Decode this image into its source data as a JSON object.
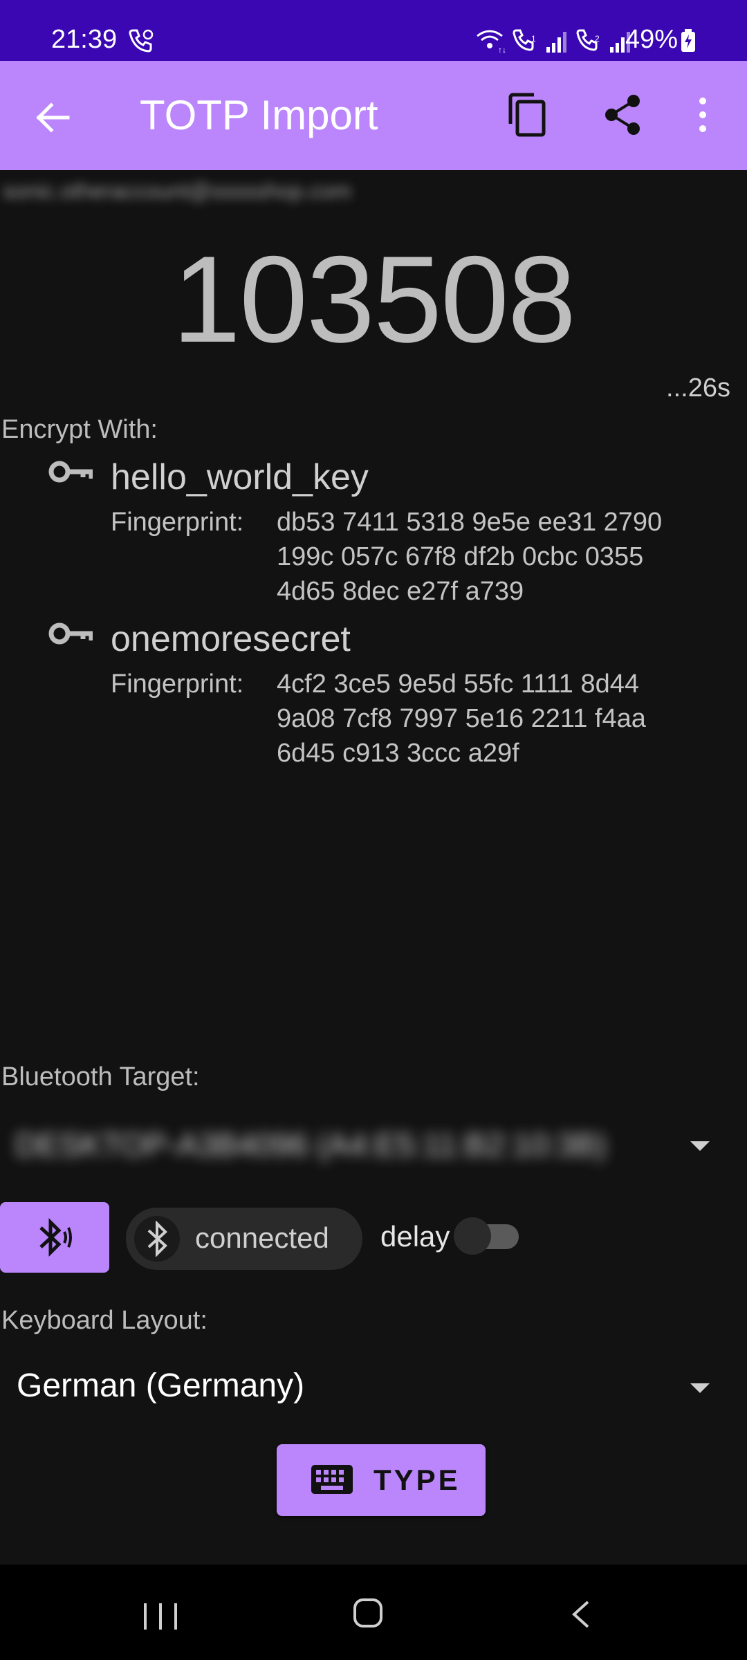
{
  "status_bar": {
    "time": "21:39",
    "battery": "49%",
    "icons": [
      "wifi-call-icon",
      "volte-icon",
      "signal-sim1-icon",
      "volte-sim2-icon",
      "signal-sim2-icon",
      "battery-charging-icon"
    ]
  },
  "app_bar": {
    "title": "TOTP Import",
    "icons": [
      "back-arrow-icon",
      "copy-icon",
      "share-icon",
      "more-vert-icon"
    ],
    "color": "#bb86fc"
  },
  "account": {
    "label": "sonic.otheraccount@ssssshop.com"
  },
  "otp": {
    "code": "103508",
    "countdown": "...26s"
  },
  "encrypt": {
    "label": "Encrypt With:",
    "fingerprint_label": "Fingerprint:",
    "keys": [
      {
        "name": "hello_world_key",
        "fingerprint_lines": [
          "db53 7411 5318 9e5e ee31 2790",
          "199c 057c 67f8 df2b 0cbc 0355",
          "4d65 8dec e27f a739"
        ]
      },
      {
        "name": "onemoresecret",
        "fingerprint_lines": [
          "4cf2 3ce5 9e5d 55fc 1111 8d44",
          "9a08 7cf8 7997 5e16 2211 f4aa",
          "6d45 c913 3ccc a29f"
        ]
      }
    ]
  },
  "bluetooth": {
    "label": "Bluetooth Target:",
    "selected": "DESKTOP-A3B4096 (A4:E5:11:B2:10:3B)",
    "connection_status": "connected",
    "delay_label": "delay",
    "delay_enabled": false
  },
  "keyboard": {
    "label": "Keyboard Layout:",
    "selected": "German (Germany)"
  },
  "type_button": {
    "label": "TYPE"
  },
  "nav_bar": {
    "icons": [
      "recent-apps-icon",
      "home-icon",
      "back-icon"
    ]
  }
}
